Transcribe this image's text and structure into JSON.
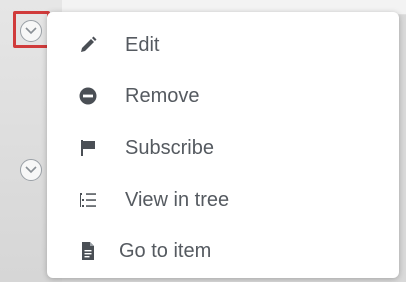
{
  "menu": {
    "items": [
      {
        "label": "Edit",
        "icon": "pencil-icon"
      },
      {
        "label": "Remove",
        "icon": "minus-circle-icon"
      },
      {
        "label": "Subscribe",
        "icon": "flag-icon"
      },
      {
        "label": "View in tree",
        "icon": "tree-list-icon"
      },
      {
        "label": "Go to item",
        "icon": "document-icon"
      }
    ]
  },
  "colors": {
    "icon": "#4a4f55",
    "label": "#555a60",
    "highlight": "#d03b3b",
    "toggle_border": "#9aa0a6"
  }
}
